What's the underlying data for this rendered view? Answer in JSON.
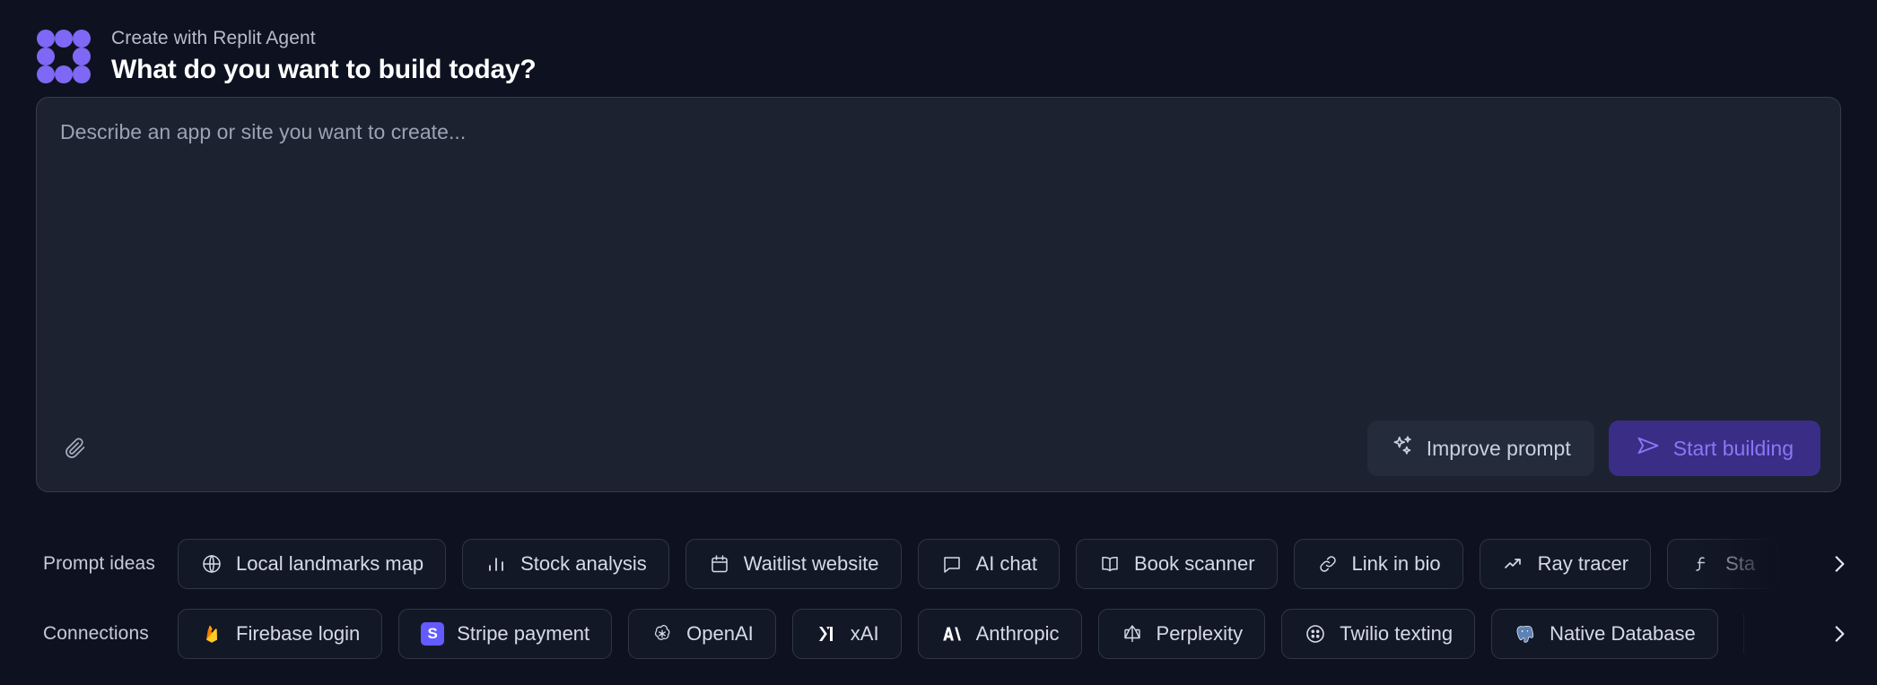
{
  "header": {
    "logo_name": "replit-logo",
    "eyebrow": "Create with Replit Agent",
    "headline": "What do you want to build today?",
    "logo_color": "#7f68f5"
  },
  "composer": {
    "placeholder": "Describe an app or site you want to create...",
    "value": "",
    "attach_icon": "paperclip-icon",
    "improve_label": "Improve prompt",
    "improve_icon": "sparkles-icon",
    "start_label": "Start building",
    "start_icon": "send-icon",
    "start_bg": "#3a2d86",
    "start_fg": "#8a77f7"
  },
  "prompt_ideas": {
    "label": "Prompt ideas",
    "items": [
      {
        "label": "Local landmarks map",
        "icon": "globe-icon"
      },
      {
        "label": "Stock analysis",
        "icon": "bar-chart-icon"
      },
      {
        "label": "Waitlist website",
        "icon": "calendar-icon"
      },
      {
        "label": "AI chat",
        "icon": "message-square-icon"
      },
      {
        "label": "Book scanner",
        "icon": "open-book-icon"
      },
      {
        "label": "Link in bio",
        "icon": "link-icon"
      },
      {
        "label": "Ray tracer",
        "icon": "trending-up-icon"
      },
      {
        "label": "Sta",
        "icon": "function-icon"
      }
    ],
    "next_icon": "chevron-right-icon"
  },
  "connections": {
    "label": "Connections",
    "items": [
      {
        "label": "Firebase login",
        "icon": "firebase-icon"
      },
      {
        "label": "Stripe payment",
        "icon": "stripe-icon"
      },
      {
        "label": "OpenAI",
        "icon": "openai-icon"
      },
      {
        "label": "xAI",
        "icon": "xai-icon"
      },
      {
        "label": "Anthropic",
        "icon": "anthropic-icon"
      },
      {
        "label": "Perplexity",
        "icon": "perplexity-icon"
      },
      {
        "label": "Twilio texting",
        "icon": "twilio-icon"
      },
      {
        "label": "Native Database",
        "icon": "postgresql-icon"
      }
    ],
    "next_icon": "chevron-right-icon"
  },
  "colors": {
    "page_bg": "#0e1220",
    "composer_bg": "#1c2230",
    "composer_border": "#343c4d",
    "chip_border": "#2e3647"
  }
}
